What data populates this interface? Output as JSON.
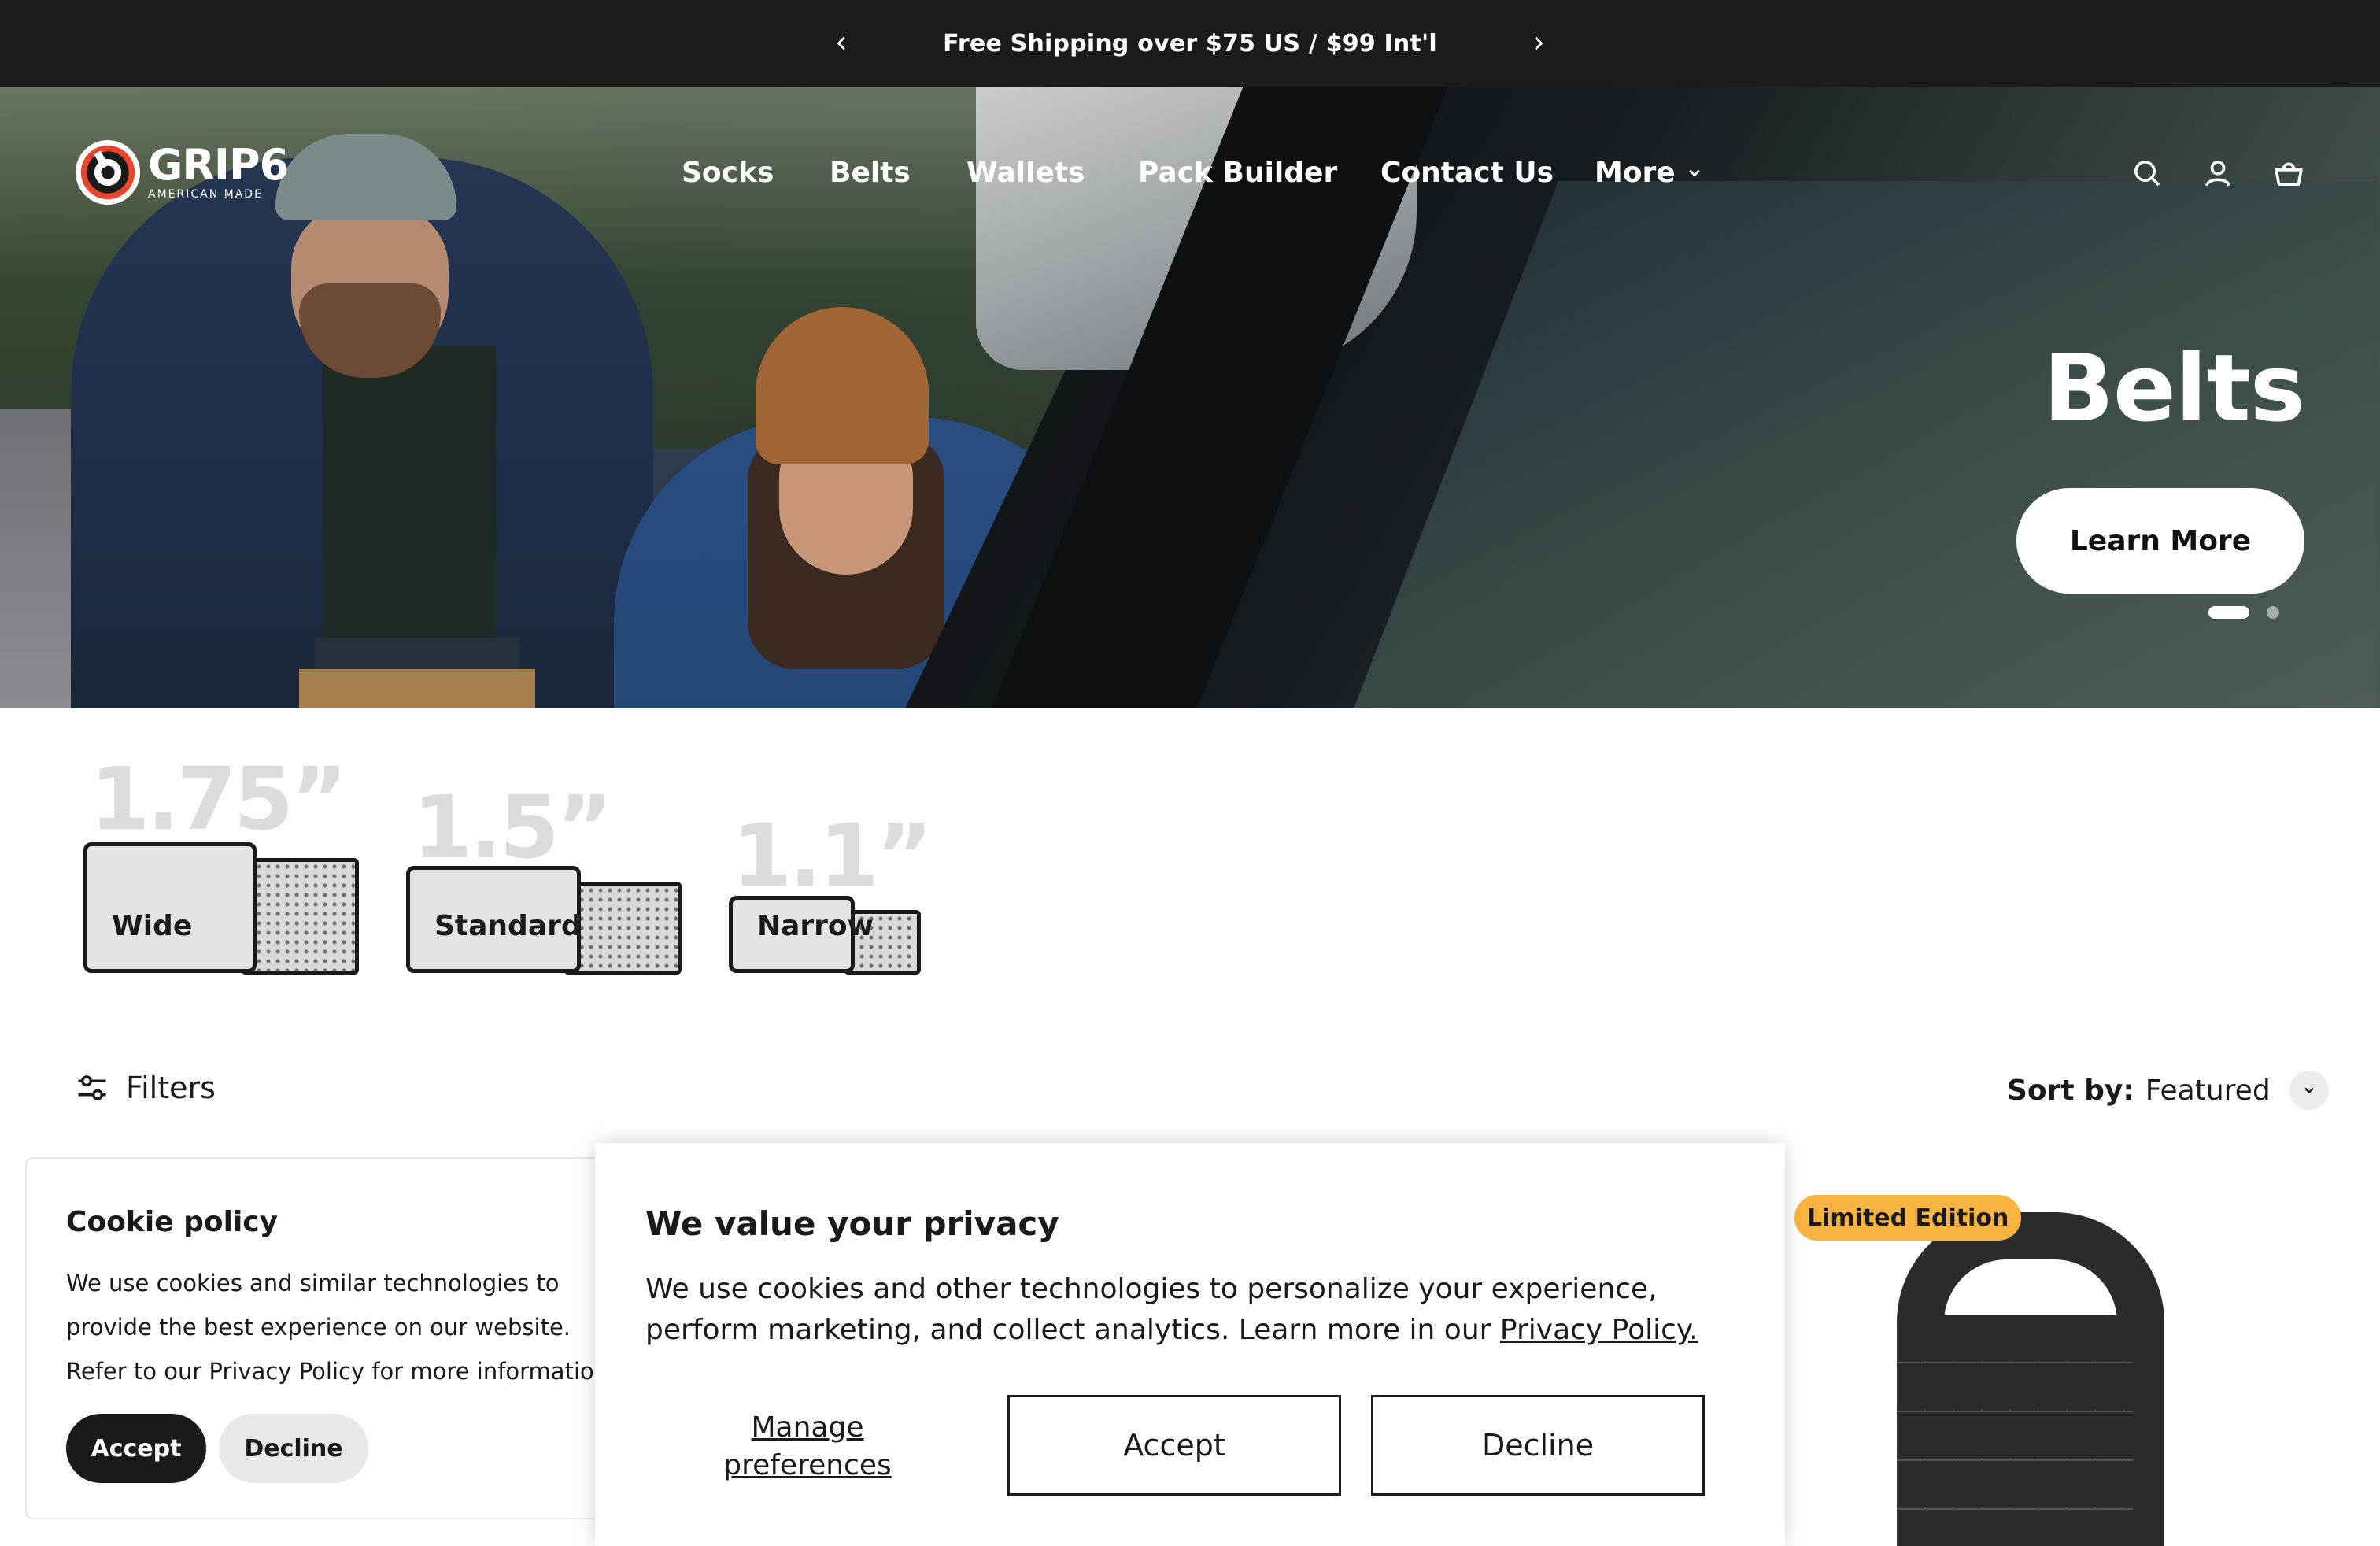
{
  "announcement": {
    "message": "Free Shipping over $75 US / $99 Int'l",
    "prev_icon": "chevron-left-icon",
    "next_icon": "chevron-right-icon"
  },
  "brand": {
    "name": "GRIP6",
    "tagline": "AMERICAN MADE",
    "accent": "#e8452c"
  },
  "nav": {
    "items": [
      "Socks",
      "Belts",
      "Wallets",
      "Pack Builder",
      "Contact Us",
      "More"
    ]
  },
  "header_icons": [
    "search-icon",
    "account-icon",
    "cart-icon"
  ],
  "hero": {
    "title": "Belts",
    "cta": "Learn More",
    "slides_total": 2,
    "slide_active": 1
  },
  "widths": [
    {
      "size": "1.75”",
      "label": "Wide"
    },
    {
      "size": "1.5”",
      "label": "Standard"
    },
    {
      "size": "1.1”",
      "label": "Narrow"
    }
  ],
  "toolbar": {
    "filters_label": "Filters",
    "sort_key": "Sort by:",
    "sort_value": "Featured"
  },
  "product": {
    "badge": "Limited Edition",
    "badge_color": "#f7b441"
  },
  "cookie_policy": {
    "title": "Cookie policy",
    "text": "We use cookies and similar technologies to provide the best experience on our website. Refer to our Privacy Policy for more information.",
    "accept": "Accept",
    "decline": "Decline"
  },
  "privacy_modal": {
    "title": "We value your privacy",
    "text": "We use cookies and other technologies to personalize your experience, perform marketing, and collect analytics. Learn more in our ",
    "link": "Privacy Policy.",
    "manage": "Manage preferences",
    "accept": "Accept",
    "decline": "Decline"
  }
}
